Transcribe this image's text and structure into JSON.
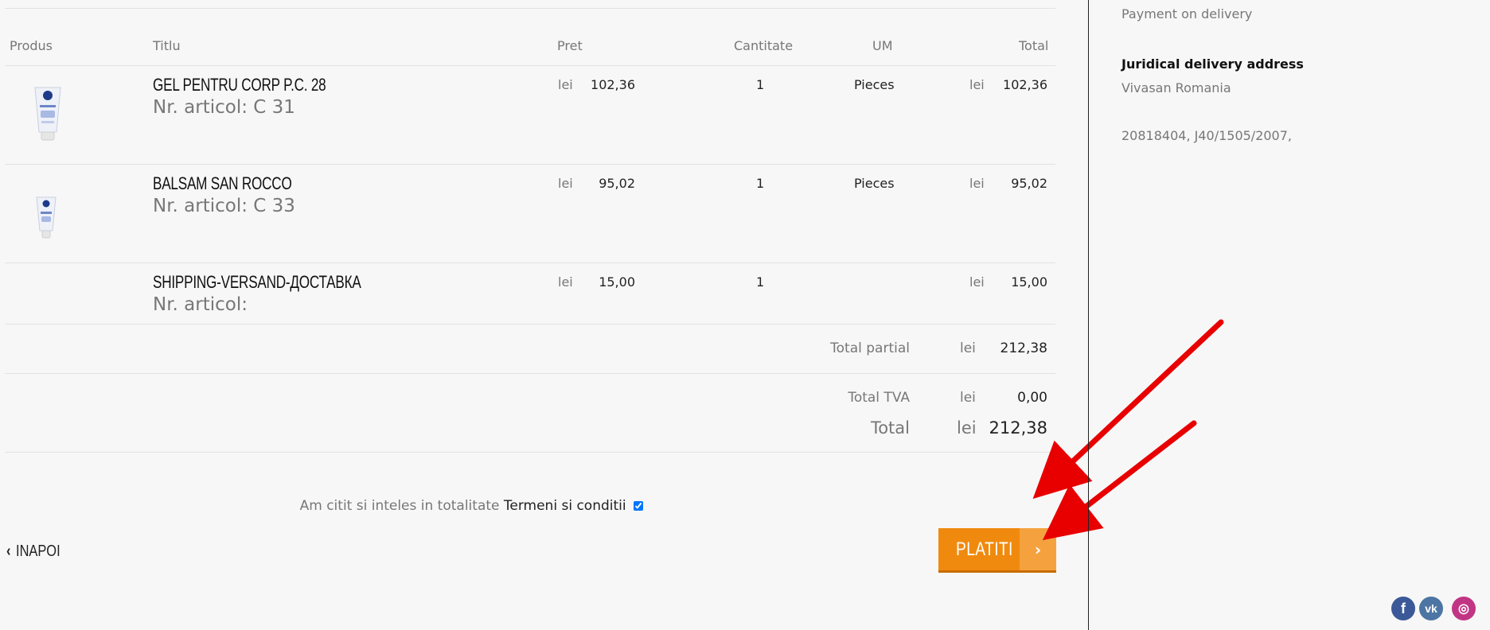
{
  "table": {
    "headers": {
      "produs": "Produs",
      "titlu": "Titlu",
      "pret": "Pret",
      "cantitate": "Cantitate",
      "um": "UM",
      "total": "Total"
    },
    "rows": [
      {
        "title": "GEL PENTRU CORP P.C. 28",
        "article": "Nr. articol: C 31",
        "price_currency": "lei",
        "price": "102,36",
        "quantity": "1",
        "um": "Pieces",
        "total_currency": "lei",
        "total": "102,36"
      },
      {
        "title": "BALSAM SAN ROCCO",
        "article": "Nr. articol: C 33",
        "price_currency": "lei",
        "price": "95,02",
        "quantity": "1",
        "um": "Pieces",
        "total_currency": "lei",
        "total": "95,02"
      },
      {
        "title": "SHIPPING-VERSAND-ДОСТАВКА",
        "article": "Nr. articol:",
        "price_currency": "lei",
        "price": "15,00",
        "quantity": "1",
        "um": "",
        "total_currency": "lei",
        "total": "15,00"
      }
    ]
  },
  "summary": {
    "partial_label": "Total partial",
    "partial_currency": "lei",
    "partial_value": "212,38",
    "vat_label": "Total TVA",
    "vat_currency": "lei",
    "vat_value": "0,00",
    "total_label": "Total",
    "total_currency": "lei",
    "total_value": "212,38"
  },
  "terms": {
    "prefix": "Am citit si inteles in totalitate",
    "link": "Termeni si conditii",
    "checked": true
  },
  "actions": {
    "back_label": "INAPOI",
    "pay_label": "PLATITI",
    "pay_arrow": "›",
    "back_arrow": "‹"
  },
  "sidebar": {
    "payment_method": "Payment on delivery",
    "juridical_heading": "Juridical delivery address",
    "company_name": "Vivasan Romania",
    "company_ids": "20818404, J40/1505/2007,"
  },
  "social": {
    "facebook_letter": "f",
    "vk_letter": "vk",
    "instagram_letter": "◎",
    "colors": {
      "facebook": "#3b5998",
      "vk": "#4c75a3",
      "instagram": "#c13584"
    }
  },
  "colors": {
    "accent": "#f08a0e",
    "accent_light": "#f5a23e",
    "arrow_red": "#e80000"
  }
}
